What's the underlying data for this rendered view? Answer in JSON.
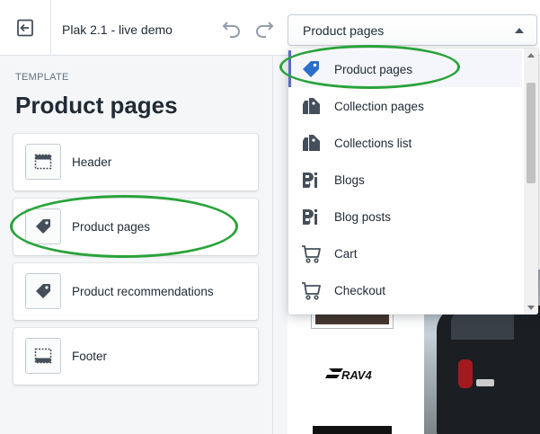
{
  "topbar": {
    "theme_name": "Plak 2.1 - live demo",
    "exit_icon": "exit-icon",
    "undo_icon": "undo-icon",
    "redo_icon": "redo-icon",
    "template_select": {
      "value": "Product pages",
      "icon": "caret-up-icon"
    }
  },
  "sidebar": {
    "label": "TEMPLATE",
    "title": "Product pages",
    "sections": [
      {
        "label": "Header",
        "icon": "header-icon"
      },
      {
        "label": "Product pages",
        "icon": "tag-icon"
      },
      {
        "label": "Product recommendations",
        "icon": "tag-icon"
      },
      {
        "label": "Footer",
        "icon": "footer-icon"
      }
    ]
  },
  "dropdown": {
    "selected_index": 0,
    "items": [
      {
        "label": "Product pages",
        "icon": "tag-icon"
      },
      {
        "label": "Collection pages",
        "icon": "tags-icon"
      },
      {
        "label": "Collections list",
        "icon": "tags-icon"
      },
      {
        "label": "Blogs",
        "icon": "blog-icon"
      },
      {
        "label": "Blog posts",
        "icon": "blog-icon"
      },
      {
        "label": "Cart",
        "icon": "cart-icon"
      },
      {
        "label": "Checkout",
        "icon": "cart-icon"
      }
    ]
  },
  "preview": {
    "logo_text": "RAV4"
  },
  "colors": {
    "accent": "#5c6ac4",
    "selected_tag": "#2c6ecb",
    "annotation": "#2aa33a",
    "text": "#212b36",
    "subdued": "#637381"
  }
}
